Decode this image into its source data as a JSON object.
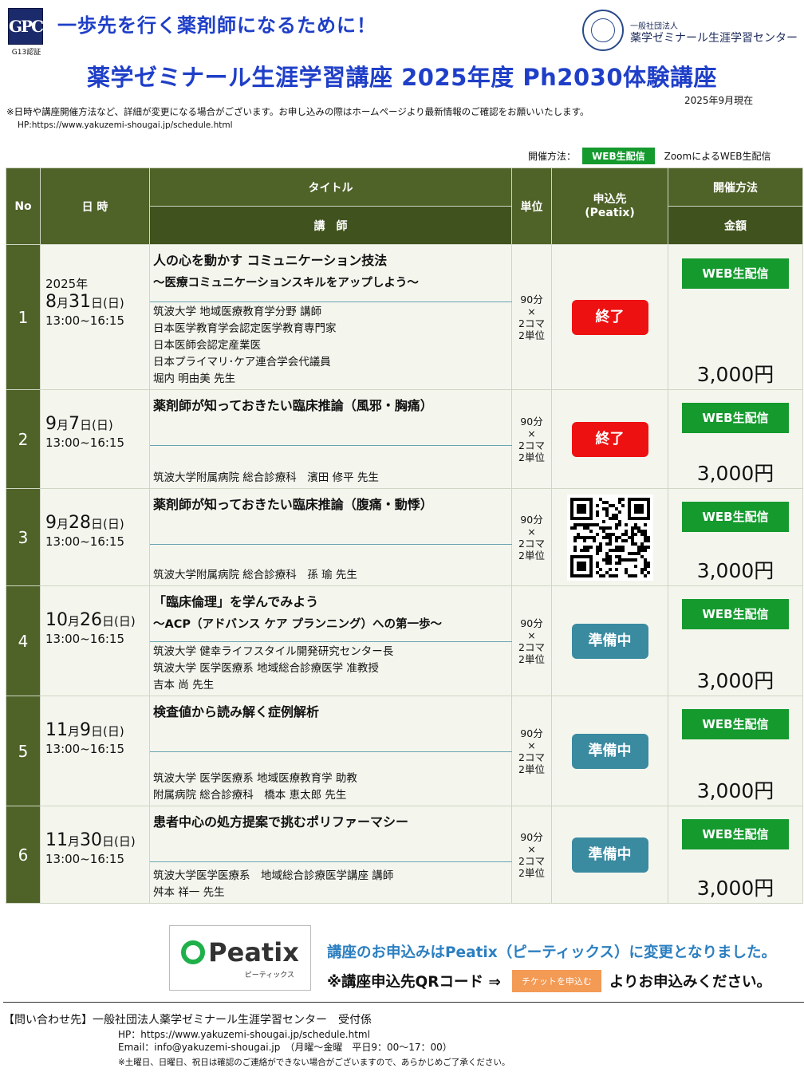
{
  "header": {
    "logo_text": "GPC",
    "logo_caption": "G13認証",
    "tagline": "一歩先を行く薬剤師になるために！",
    "org_small": "一般社団法人",
    "org_name": "薬学ゼミナール生涯学習センター",
    "main_title": "薬学ゼミナール生涯学習講座 2025年度 Ph2030体験講座",
    "as_of": "2025年9月現在",
    "note": "※日時や講座開催方法など、詳細が変更になる場合がございます。お申し込みの際はホームページより最新情報のご確認をお願いいたします。",
    "hp": "HP:https://www.yakuzemi-shougai.jp/schedule.html"
  },
  "legend": {
    "label": "開催方法：",
    "badge": "WEB生配信",
    "desc": "ZoomによるWEB生配信"
  },
  "table_headers": {
    "no": "No",
    "date": "日 時",
    "title": "タイトル",
    "lecturer": "講　師",
    "unit": "単位",
    "apply": "申込先\n(Peatix)",
    "method": "開催方法",
    "price": "金額"
  },
  "rows": [
    {
      "no": "1",
      "year": "2025年",
      "month": "8",
      "day": "31",
      "weekday": "日(日)",
      "time": "13:00~16:15",
      "title": "人の心を動かす コミュニケーション技法",
      "subtitle": "～医療コミュニケーションスキルをアップしよう～",
      "lecturer": [
        "筑波大学 地域医療教育学分野 講師",
        "日本医学教育学会認定医学教育専門家",
        "日本医師会認定産業医",
        "日本プライマリ･ケア連合学会代議員",
        "堀内 明由美 先生"
      ],
      "unit": [
        "90分",
        "×",
        "2コマ",
        "2単位"
      ],
      "apply": "終了",
      "apply_status": "ended",
      "method": "WEB生配信",
      "price": "3,000円"
    },
    {
      "no": "2",
      "year": "",
      "month": "9",
      "day": "7",
      "weekday": "日(日)",
      "time": "13:00~16:15",
      "title": "薬剤師が知っておきたい臨床推論（風邪・胸痛）",
      "subtitle": "",
      "lecturer": [
        "筑波大学附属病院 総合診療科　濱田 修平 先生"
      ],
      "unit": [
        "90分",
        "×",
        "2コマ",
        "2単位"
      ],
      "apply": "終了",
      "apply_status": "ended",
      "method": "WEB生配信",
      "price": "3,000円"
    },
    {
      "no": "3",
      "year": "",
      "month": "9",
      "day": "28",
      "weekday": "日(日)",
      "time": "13:00~16:15",
      "title": "薬剤師が知っておきたい臨床推論（腹痛・動悸）",
      "subtitle": "",
      "lecturer": [
        "筑波大学附属病院 総合診療科　孫 瑜 先生"
      ],
      "unit": [
        "90分",
        "×",
        "2コマ",
        "2単位"
      ],
      "apply": "",
      "apply_status": "qr",
      "method": "WEB生配信",
      "price": "3,000円"
    },
    {
      "no": "4",
      "year": "",
      "month": "10",
      "day": "26",
      "weekday": "日(日)",
      "time": "13:00~16:15",
      "title": "「臨床倫理」を学んでみよう",
      "subtitle": "～ACP（アドバンス ケア プランニング）への第一歩～",
      "lecturer": [
        "筑波大学 健幸ライフスタイル開発研究センター長",
        "筑波大学 医学医療系 地域総合診療医学 准教授",
        "吉本 尚 先生"
      ],
      "unit": [
        "90分",
        "×",
        "2コマ",
        "2単位"
      ],
      "apply": "準備中",
      "apply_status": "prep",
      "method": "WEB生配信",
      "price": "3,000円"
    },
    {
      "no": "5",
      "year": "",
      "month": "11",
      "day": "9",
      "weekday": "日(日)",
      "time": "13:00~16:15",
      "title": "検査値から読み解く症例解析",
      "subtitle": "",
      "lecturer": [
        "筑波大学 医学医療系 地域医療教育学 助教",
        "附属病院 総合診療科　橋本 恵太郎 先生"
      ],
      "unit": [
        "90分",
        "×",
        "2コマ",
        "2単位"
      ],
      "apply": "準備中",
      "apply_status": "prep",
      "method": "WEB生配信",
      "price": "3,000円"
    },
    {
      "no": "6",
      "year": "",
      "month": "11",
      "day": "30",
      "weekday": "日(日)",
      "time": "13:00~16:15",
      "title": "患者中心の処方提案で挑むポリファーマシー",
      "subtitle": "",
      "lecturer": [
        "筑波大学医学医療系　地域総合診療医学講座 講師",
        "舛本 祥一 先生"
      ],
      "unit": [
        "90分",
        "×",
        "2コマ",
        "2単位"
      ],
      "apply": "準備中",
      "apply_status": "prep",
      "method": "WEB生配信",
      "price": "3,000円"
    }
  ],
  "peatix": {
    "logo": "Peatix",
    "logo_kana": "ピーティックス",
    "msg1": "講座のお申込みはPeatix（ピーティックス）に変更となりました。",
    "msg2_pre": "※講座申込先QRコード ⇒",
    "ticket_label": "チケットを申込む",
    "msg2_post": "よりお申込みください。"
  },
  "contact": {
    "line1": "【問い合わせ先】一般社団法人薬学ゼミナール生涯学習センター　受付係",
    "line2": "HP：https://www.yakuzemi-shougai.jp/schedule.html",
    "line3": "Email：info@yakuzemi-shougai.jp　（月曜～金曜　平日9：00～17：00）",
    "line4": "※土曜日、日曜日、祝日は確認のご連絡ができない場合がございますので、あらかじめご了承ください。"
  },
  "colors": {
    "header_green": "#4f6228",
    "title_blue": "#1f3fc8",
    "web_badge_green": "#159a2e",
    "ended_red": "#ee1111",
    "prep_teal": "#3a8aa0"
  }
}
